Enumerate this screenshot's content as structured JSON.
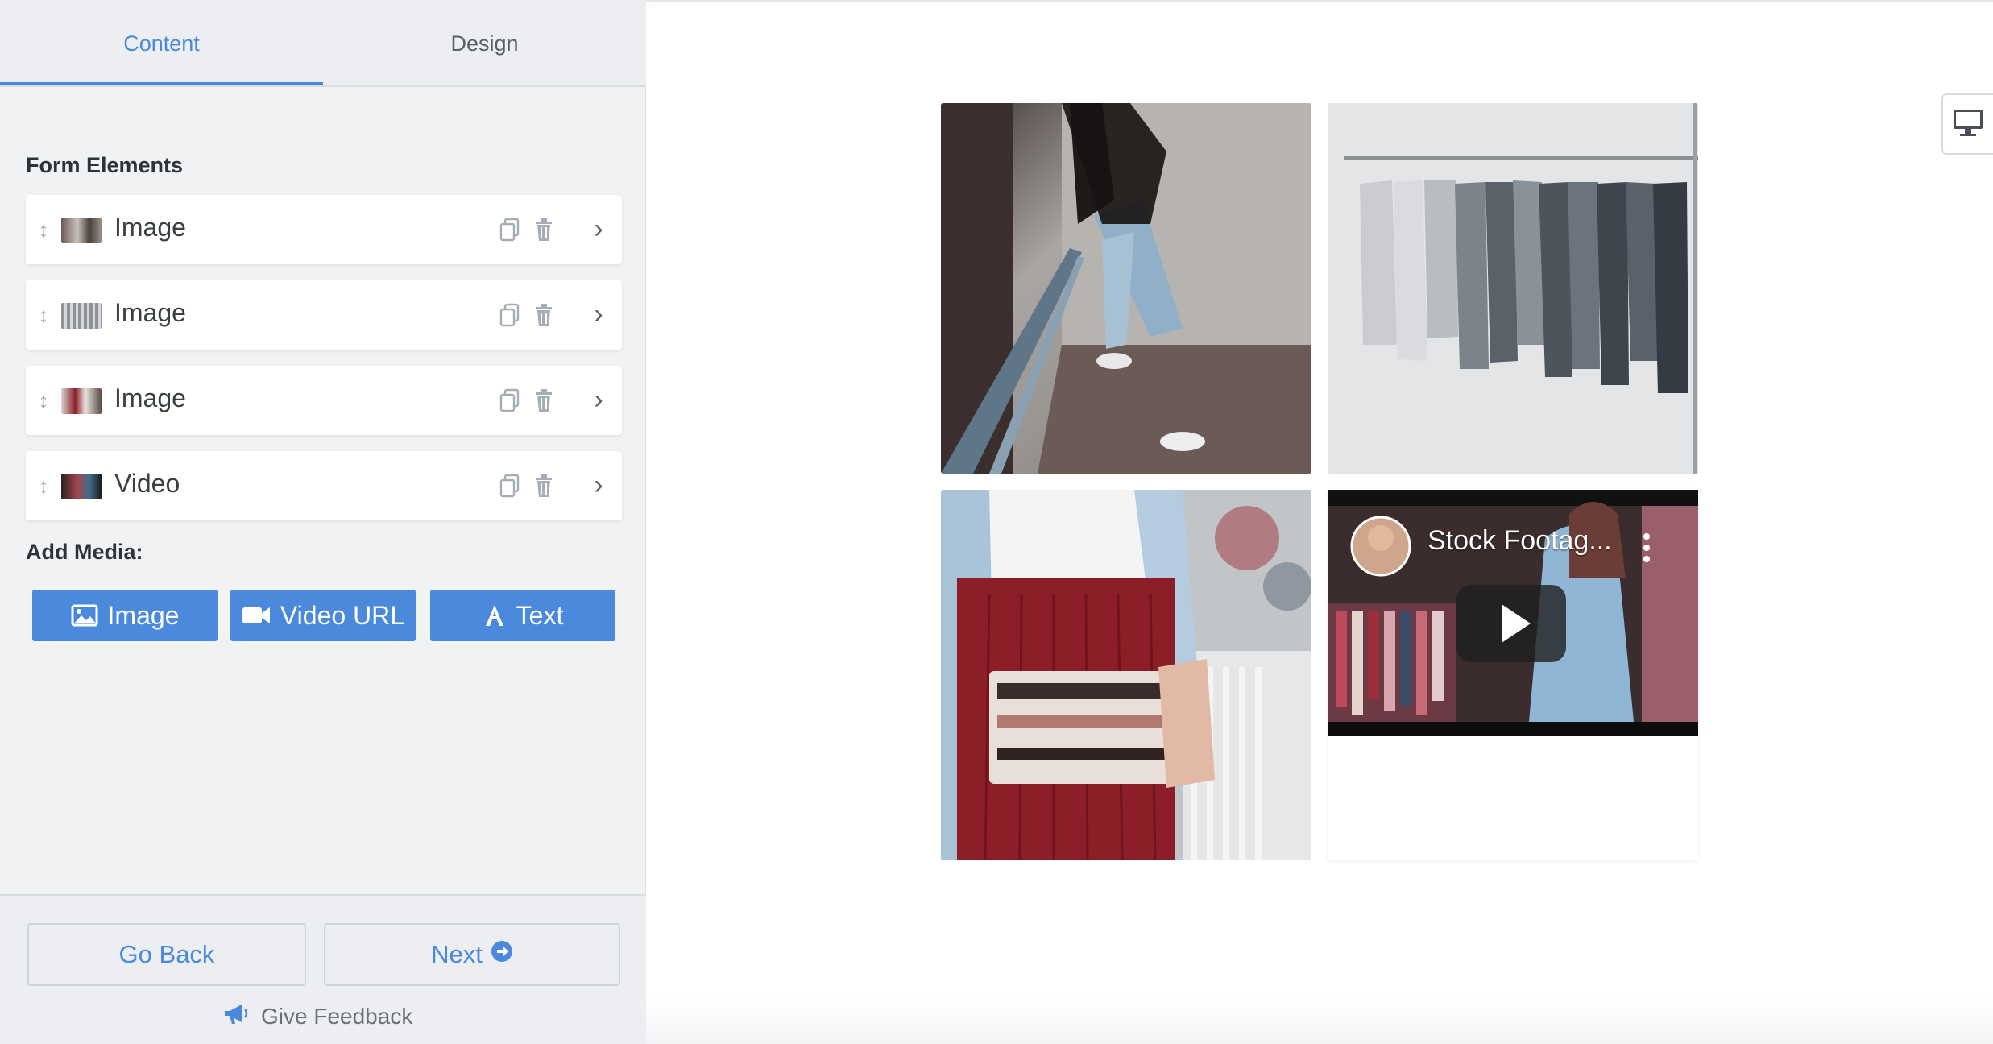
{
  "tabs": {
    "content": "Content",
    "design": "Design"
  },
  "form_elements": {
    "title": "Form Elements",
    "items": [
      {
        "label": "Image",
        "thumb_icon": "photo-thumbnail"
      },
      {
        "label": "Image",
        "thumb_icon": "photo-thumbnail"
      },
      {
        "label": "Image",
        "thumb_icon": "photo-thumbnail"
      },
      {
        "label": "Video",
        "thumb_icon": "video-thumbnail"
      }
    ]
  },
  "add_media": {
    "title": "Add Media:",
    "buttons": [
      {
        "label": "Image",
        "icon": "image-icon"
      },
      {
        "label": "Video URL",
        "icon": "video-camera-icon"
      },
      {
        "label": "Text",
        "icon": "text-a-icon"
      }
    ]
  },
  "footer": {
    "back_label": "Go Back",
    "next_label": "Next",
    "feedback_label": "Give Feedback"
  },
  "preview": {
    "video_title": "Stock Footag..."
  },
  "colors": {
    "accent": "#4a89dc",
    "panel_bg": "#f1f2f4"
  }
}
